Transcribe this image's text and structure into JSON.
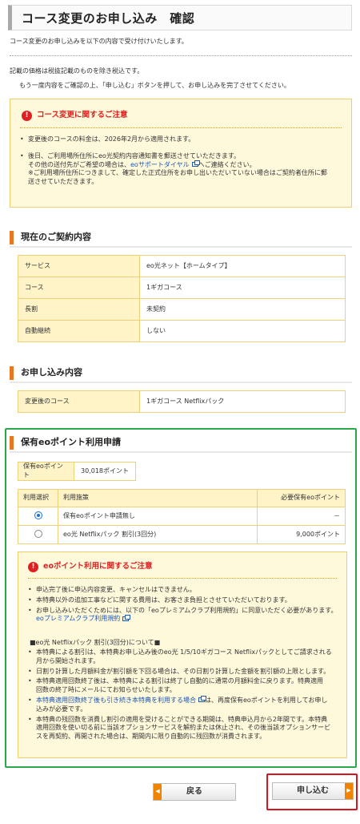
{
  "page": {
    "title": "コース変更のお申し込み　確認"
  },
  "intro": {
    "line1": "コース変更のお申し込みを以下の内容で受け付けいたします。",
    "line2": "記載の価格は税抜記載のものを除き税込です。",
    "line3": "もう一度内容をご確認の上、「申し込む」ボタンを押して、お申し込みを完了させてください。"
  },
  "notice": {
    "title": "コース変更に関するご注意",
    "item1": "変更後のコースの料金は、2026年2月から適用されます。",
    "item2_a": "後日、ご利用場所住所にeo光契約内容通知書を郵送させていただきます。",
    "item2_b_pre": "その他の送付先がご希望の場合は、",
    "item2_b_link": "eoサポートダイヤル",
    "item2_b_post": "へご連絡ください。",
    "item2_c": "※ご利用場所住所につきまして、確定した正式住所をお申し出いただいていない場合はご契約者住所に郵",
    "item2_d": "送させていただきます。"
  },
  "current_contract": {
    "heading": "現在のご契約内容",
    "rows": [
      {
        "key": "サービス",
        "value": "eo光ネット【ホームタイプ】"
      },
      {
        "key": "コース",
        "value": "1ギガコース"
      },
      {
        "key": "長割",
        "value": "未契約"
      },
      {
        "key": "自動継続",
        "value": "しない"
      }
    ]
  },
  "application": {
    "heading": "お申し込み内容",
    "rows": [
      {
        "key": "変更後のコース",
        "value": "1ギガコース Netflixパック"
      }
    ]
  },
  "points": {
    "heading": "保有eoポイント利用申請",
    "held_label": "保有eoポイント",
    "held_value": "30,018ポイント",
    "table_headers": {
      "select": "利用選択",
      "measure": "利用施策",
      "required": "必要保有eoポイント"
    },
    "options": [
      {
        "label": "保有eoポイント申請無し",
        "required": "－",
        "selected": true
      },
      {
        "label": "eo光 Netflixパック 割引(3回分)",
        "required": "9,000ポイント",
        "selected": false
      }
    ]
  },
  "points_notice": {
    "title": "eoポイント利用に関するご注意",
    "item1": "申込完了後に申込内容変更、キャンセルはできません。",
    "item2": "本特典以外の追加工事などに関する費用は、お客さま負担とさせていただいております。",
    "item3_a": "お申し込みいただくためには、以下の「eoプレミアムクラブ利用規約」に同意いただく必要があります。",
    "item3_link": "eoプレミアムクラブ利用規約",
    "subhead": "■eo光 Netflixパック 割引(3回分)について■",
    "b1_a": "本特典による割引は、本特典お申し込み後のeo光 1/5/10ギガコース Netflixパックとしてご請求される",
    "b1_b": "月から開始されます。",
    "b2": "日割り計算した月額料金が割引額を下回る場合は、その日割り計算した金額を割引額の上限とします。",
    "b3_a": "本特典適用回数終了後は、本特典による割引は終了し自動的に通常の月額料金に戻ります。特典適用",
    "b3_b": "回数の終了時にメールにてお知らせいたします。",
    "b4_link": "本特典適用回数終了後も引き続き本特典を利用する場合",
    "b4_post": "は、再度保有eoポイントを利用してお申し",
    "b4_b": "込みが必要です。",
    "b5_a": "本特典の残回数を消費し割引の適用を受けることができる期間は、特典申込月から2年間です。本特典",
    "b5_b": "適用回数を使い切る前に当該オプションサービスを解約または休止され、その後当該オプションサービ",
    "b5_c": "スを再契約、再開された場合は、期間内に限り自動的に残回数が消費されます。"
  },
  "buttons": {
    "back": "戻る",
    "apply": "申し込む"
  },
  "colors": {
    "accent": "#e87722",
    "alert": "#e02020",
    "highlight_green": "#2aa84a",
    "highlight_red": "#d8141e",
    "link": "#1a56b4"
  }
}
